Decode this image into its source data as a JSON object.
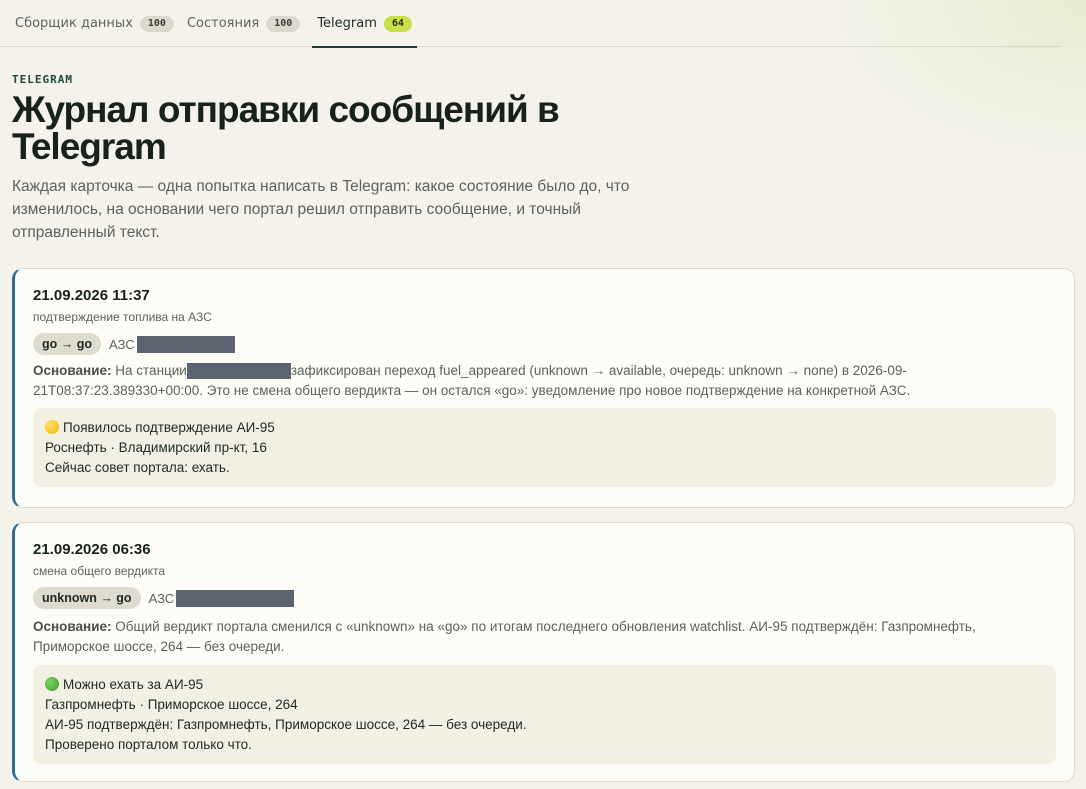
{
  "tabs": [
    {
      "label": "Сборщик данных",
      "count": "100"
    },
    {
      "label": "Состояния",
      "count": "100"
    },
    {
      "label": "Telegram",
      "count": "64"
    }
  ],
  "header": {
    "eyebrow": "TELEGRAM",
    "title": "Журнал отправки сообщений в Telegram",
    "subtitle": "Каждая карточка — одна попытка написать в Telegram: какое состояние было до, что изменилось, на основании чего портал решил отправить сообщение, и точный отправленный текст."
  },
  "cards": [
    {
      "date": "21.09.2026 11:37",
      "kind": "подтверждение топлива на АЗС",
      "transition": "go → go",
      "station_label": "АЗС",
      "reason_label": "Основание:",
      "reason_part1": "На станции",
      "reason_part2": "зафиксирован переход fuel_appeared (unknown → available, очередь: unknown → none) в 2026-09-21T08:37:23.389330+00:00. Это не смена общего вердикта — он остался «go»: уведомление про новое подтверждение на конкретной АЗС.",
      "message_icon": "yellow-circle-icon",
      "message_lines": [
        "Появилось подтверждение АИ-95",
        "Роснефть · Владимирский пр-кт, 16",
        "Сейчас совет портала: ехать."
      ]
    },
    {
      "date": "21.09.2026 06:36",
      "kind": "смена общего вердикта",
      "transition": "unknown → go",
      "station_label": "АЗС",
      "reason_label": "Основание:",
      "reason_text": "Общий вердикт портала сменился с «unknown» на «go» по итогам последнего обновления watchlist. АИ-95 подтверждён: Газпромнефть, Приморское шоссе, 264 — без очереди.",
      "message_icon": "green-circle-icon",
      "message_lines": [
        "Можно ехать за АИ-95",
        "Газпромнефть · Приморское шоссе, 264",
        "АИ-95 подтверждён: Газпромнефть, Приморское шоссе, 264 — без очереди.",
        "Проверено порталом только что."
      ]
    }
  ],
  "colors": {
    "accent_border": "#2f6c99",
    "active_badge": "#c9e04a",
    "tab_underline": "#1f3d33",
    "redaction": "#5b6370"
  }
}
